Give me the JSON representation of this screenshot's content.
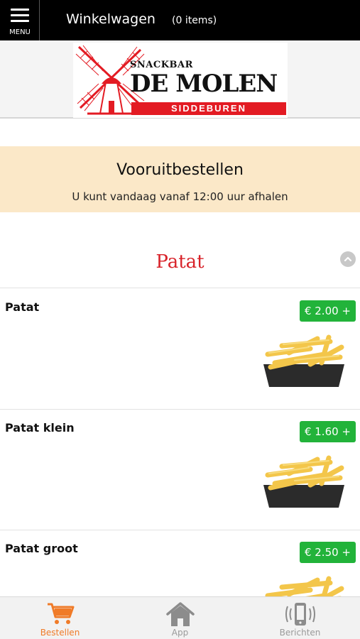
{
  "header": {
    "menu_label": "MENU",
    "cart_title": "Winkelwagen",
    "cart_count": "(0 items)"
  },
  "logo": {
    "snackbar": "SNACKBAR",
    "name": "DE MOLEN",
    "place": "SIDDEBUREN"
  },
  "preorder": {
    "title": "Vooruitbestellen",
    "subtitle": "U kunt vandaag vanaf 12:00 uur afhalen"
  },
  "category": {
    "title": "Patat"
  },
  "products": [
    {
      "name": "Patat",
      "price": "€ 2.00 +"
    },
    {
      "name": "Patat klein",
      "price": "€ 1.60 +"
    },
    {
      "name": "Patat groot",
      "price": "€ 2.50 +"
    }
  ],
  "bottom_nav": [
    {
      "label": "Bestellen",
      "icon": "cart-icon",
      "active": true
    },
    {
      "label": "App",
      "icon": "home-icon",
      "active": false
    },
    {
      "label": "Berichten",
      "icon": "phone-vibrate-icon",
      "active": false
    }
  ],
  "colors": {
    "header_bg": "#000000",
    "accent_red": "#d8232a",
    "price_green": "#22b33a",
    "active_nav": "#f07b28",
    "banner_bg": "#fbe8c8"
  }
}
